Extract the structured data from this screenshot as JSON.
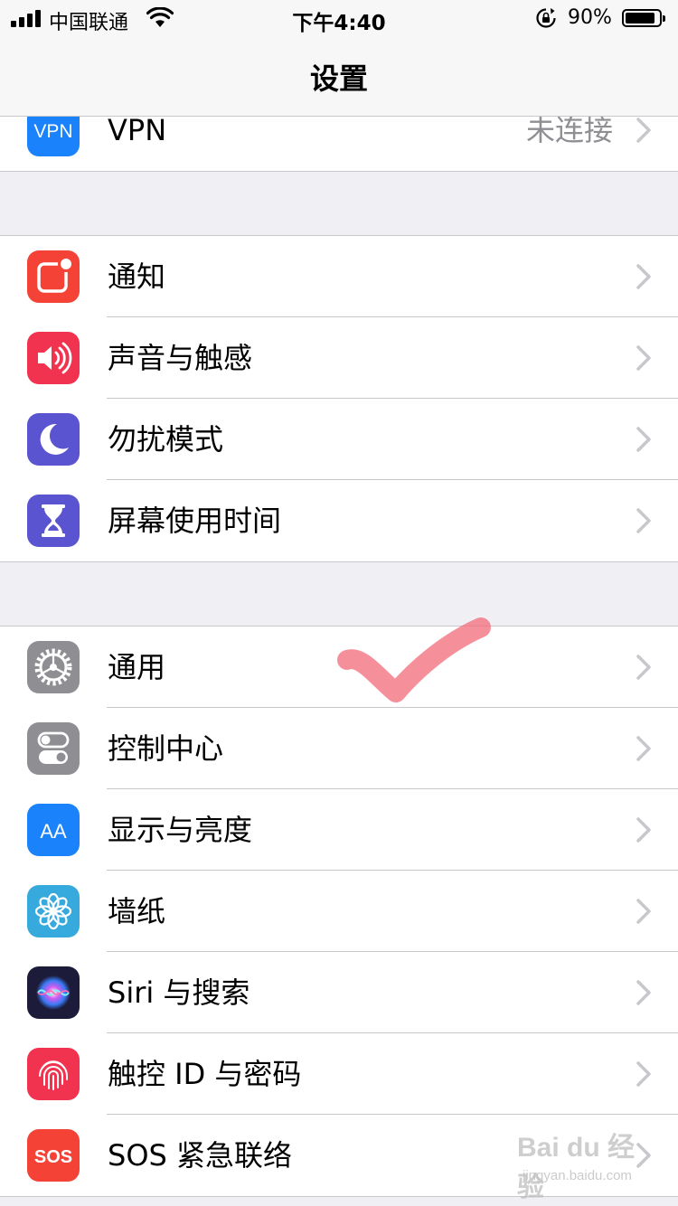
{
  "status_bar": {
    "carrier": "中国联通",
    "time": "下午4:40",
    "battery_percent": "90%",
    "battery_level": 0.9
  },
  "nav": {
    "title": "设置"
  },
  "groups": [
    {
      "items": [
        {
          "label": "VPN",
          "detail": "未连接",
          "icon": "vpn-icon",
          "color": "#1a82fb"
        }
      ]
    },
    {
      "items": [
        {
          "label": "通知",
          "icon": "notifications-icon",
          "color": "#f44336"
        },
        {
          "label": "声音与触感",
          "icon": "speaker-icon",
          "color": "#f2334f"
        },
        {
          "label": "勿扰模式",
          "icon": "moon-icon",
          "color": "#5b54d1"
        },
        {
          "label": "屏幕使用时间",
          "icon": "hourglass-icon",
          "color": "#5b54d1"
        }
      ]
    },
    {
      "items": [
        {
          "label": "通用",
          "icon": "gear-icon",
          "color": "#8e8e93"
        },
        {
          "label": "控制中心",
          "icon": "toggles-icon",
          "color": "#8e8e93"
        },
        {
          "label": "显示与亮度",
          "icon": "text-size-icon",
          "color": "#1a82fb"
        },
        {
          "label": "墙纸",
          "icon": "flower-icon",
          "color": "#36aadc"
        },
        {
          "label": "Siri 与搜索",
          "icon": "siri-icon",
          "color": "#1c1c3a"
        },
        {
          "label": "触控 ID 与密码",
          "icon": "fingerprint-icon",
          "color": "#f2334f"
        },
        {
          "label": "SOS 紧急联络",
          "icon": "sos-icon",
          "color": "#f44336"
        }
      ]
    }
  ],
  "icon_text": {
    "vpn": "VPN",
    "sos": "SOS",
    "aa": "AA"
  },
  "watermark": {
    "text": "Bai du 经验",
    "sub": "jingyan.baidu.com"
  }
}
